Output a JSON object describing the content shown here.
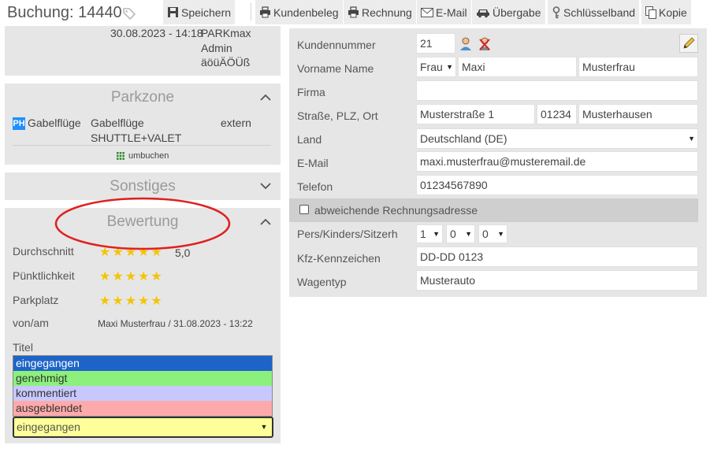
{
  "header": {
    "title": "Buchung: 14440",
    "toolbar": {
      "save": "Speichern",
      "receipt": "Kundenbeleg",
      "invoice": "Rechnung",
      "email": "E-Mail",
      "handover": "Übergabe",
      "keyring": "Schlüsselband",
      "copy": "Kopie"
    }
  },
  "booking_info": {
    "datetime": "30.08.2023 - 14:18",
    "source": "PARKmax",
    "user": "Admin",
    "extra": "äöüÄÖÜß"
  },
  "parkzone": {
    "title": "Parkzone",
    "badge": "PH",
    "zone_name": "Gabelflüge",
    "service_line1": "Gabelflüge",
    "service_line2": "SHUTTLE+VALET",
    "location": "extern",
    "rebook_link": "umbuchen"
  },
  "sonstiges": {
    "title": "Sonstiges"
  },
  "bewertung": {
    "title": "Bewertung",
    "rows": [
      {
        "label": "Durchschnitt",
        "stars": 5,
        "value": "5,0"
      },
      {
        "label": "Pünktlichkeit",
        "stars": 5,
        "value": ""
      },
      {
        "label": "Parkplatz",
        "stars": 5,
        "value": ""
      }
    ],
    "by_label": "von/am",
    "by_value": "Maxi Musterfrau / 31.08.2023 - 13:22",
    "title_label": "Titel",
    "status_options": [
      {
        "label": "eingegangen",
        "color": "#1e64c8"
      },
      {
        "label": "genehmigt",
        "color": "#8cf07c"
      },
      {
        "label": "kommentiert",
        "color": "#c8c8ff"
      },
      {
        "label": "ausgeblendet",
        "color": "#ffaaaa"
      }
    ],
    "status_selected": "eingegangen",
    "star_glyphs": "★★★★★"
  },
  "customer": {
    "labels": {
      "number": "Kundennummer",
      "name": "Vorname Name",
      "company": "Firma",
      "address": "Straße, PLZ, Ort",
      "country": "Land",
      "email": "E-Mail",
      "phone": "Telefon",
      "alt_billing": "abweichende Rechnungsadresse",
      "persons": "Pers/Kinders/Sitzerh",
      "plate": "Kfz-Kennzeichen",
      "car_type": "Wagentyp"
    },
    "values": {
      "number": "21",
      "salutation": "Frau",
      "first_name": "Maxi",
      "last_name": "Musterfrau",
      "company": "",
      "street": "Musterstraße 1",
      "zip": "01234",
      "city": "Musterhausen",
      "country": "Deutschland (DE)",
      "email": "maxi.musterfrau@musteremail.de",
      "phone": "01234567890",
      "alt_billing_checked": false,
      "persons": "1",
      "children": "0",
      "child_seats": "0",
      "plate": "DD-DD 0123",
      "car_type": "Musterauto"
    }
  },
  "colors": {
    "panel_bg": "#e6e6e6",
    "star": "#f5c400",
    "highlight": "#e02020",
    "badge": "#1e90ff"
  }
}
